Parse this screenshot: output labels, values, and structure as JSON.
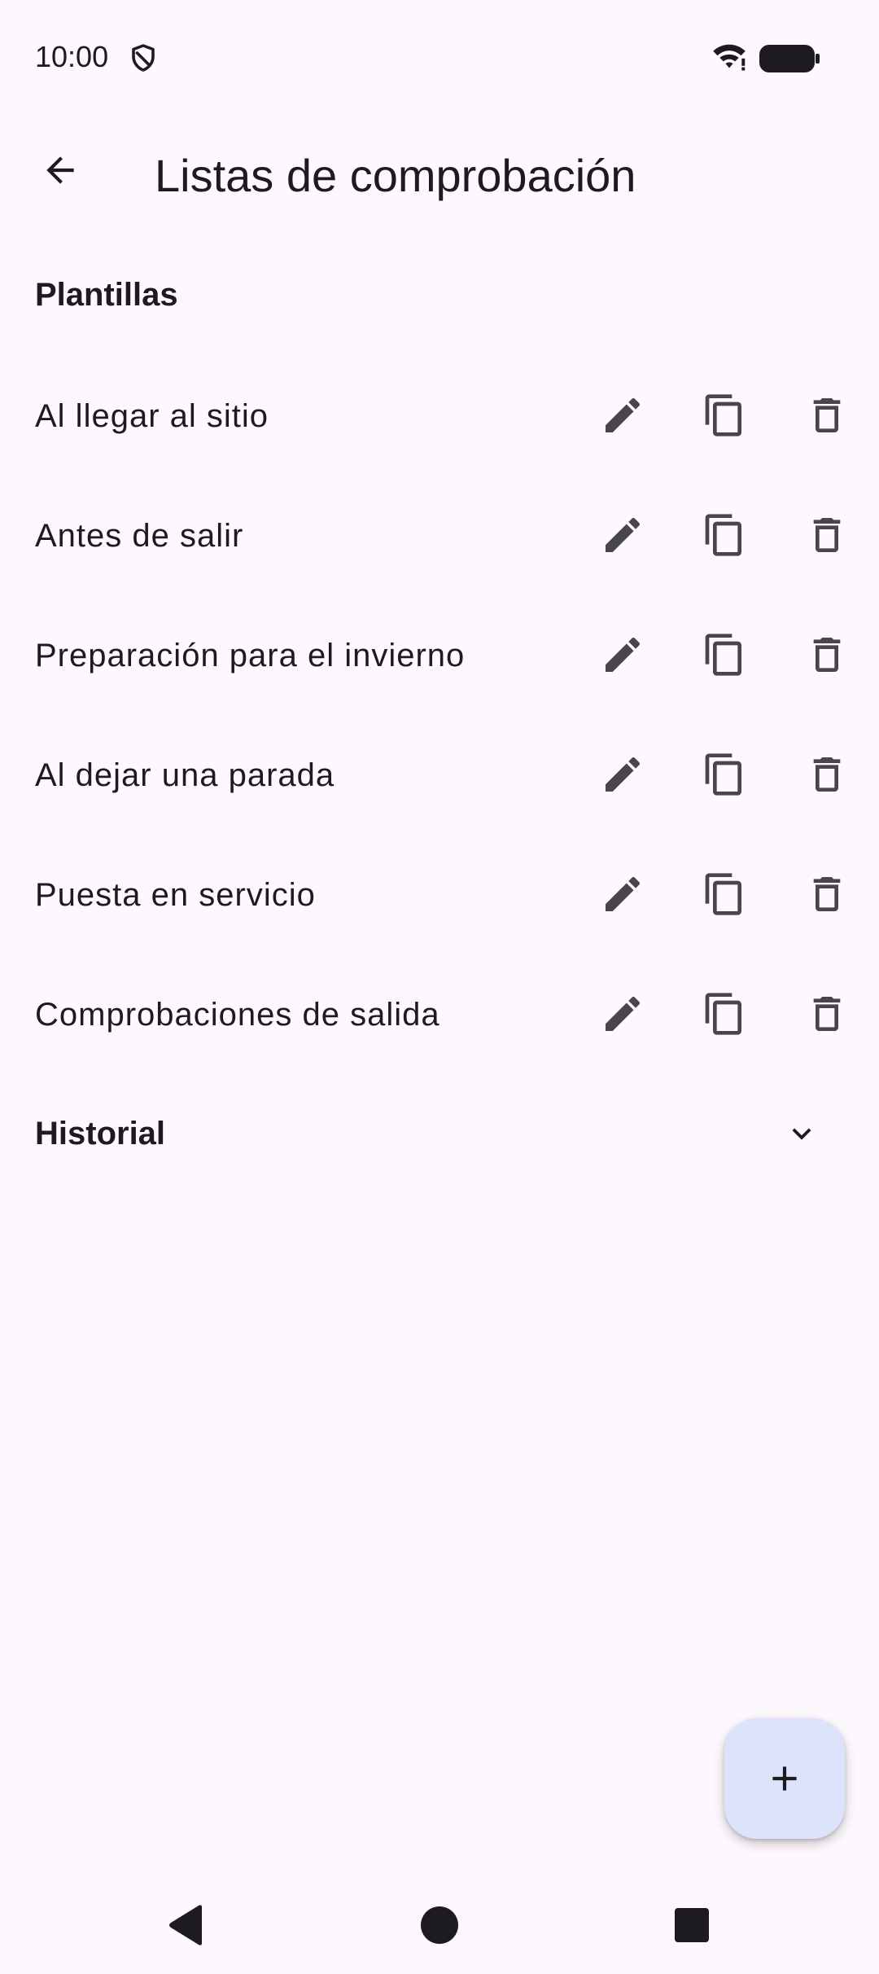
{
  "status_bar": {
    "time": "10:00",
    "icons": [
      "shield-icon",
      "wifi-icon",
      "battery-icon"
    ]
  },
  "app_bar": {
    "back_icon": "arrow-back-icon",
    "title": "Listas de comprobación"
  },
  "templates": {
    "section_title": "Plantillas",
    "items": [
      {
        "label": "Al llegar al sitio"
      },
      {
        "label": "Antes de salir"
      },
      {
        "label": "Preparación para el invierno"
      },
      {
        "label": "Al dejar una parada"
      },
      {
        "label": "Puesta en servicio"
      },
      {
        "label": "Comprobaciones de salida"
      }
    ],
    "row_actions": [
      "edit-icon",
      "copy-icon",
      "delete-icon"
    ]
  },
  "history": {
    "section_title": "Historial",
    "toggle_icon": "chevron-down-icon",
    "expanded": false
  },
  "fab": {
    "icon": "plus-icon"
  },
  "nav_bar": {
    "buttons": [
      "back-triangle-icon",
      "home-circle-icon",
      "recents-square-icon"
    ]
  },
  "colors": {
    "background": "#fdf8fd",
    "text": "#1d1b20",
    "icon": "#49454f",
    "fab_bg": "#dce3fb",
    "nav_icon": "#1d1b20"
  }
}
